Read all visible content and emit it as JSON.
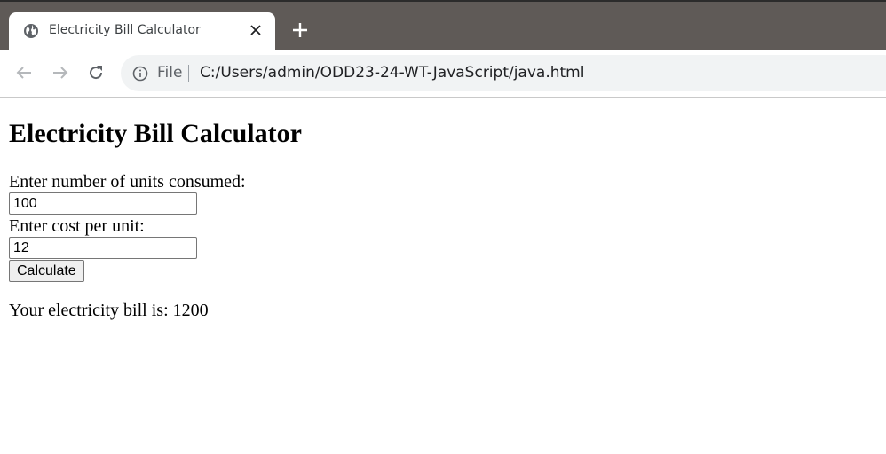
{
  "browser": {
    "tab_title": "Electricity Bill Calculator",
    "omnibox": {
      "scheme_label": "File",
      "url": "C:/Users/admin/ODD23-24-WT-JavaScript/java.html"
    },
    "icons": {
      "favicon": "globe-icon",
      "close": "close-icon",
      "new_tab": "plus-icon",
      "back": "back-arrow-icon",
      "forward": "forward-arrow-icon",
      "reload": "reload-icon",
      "info": "info-icon"
    },
    "colors": {
      "tabstrip": "#5f5a57",
      "omnibox": "#f1f3f4"
    }
  },
  "page": {
    "heading": "Electricity Bill Calculator",
    "units_label": "Enter number of units consumed:",
    "units_value": "100",
    "cost_label": "Enter cost per unit:",
    "cost_value": "12",
    "calculate_label": "Calculate",
    "result_text": "Your electricity bill is: 1200"
  }
}
